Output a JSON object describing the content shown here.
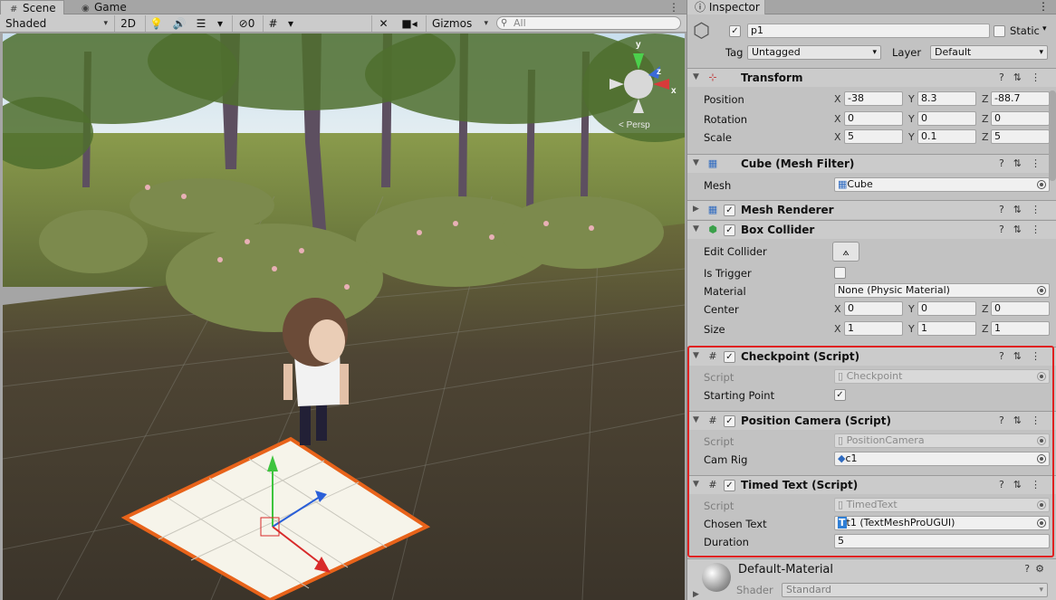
{
  "scene": {
    "tabs": [
      {
        "label": "Scene",
        "icon": "grid-icon"
      },
      {
        "label": "Game",
        "icon": "gamepad-icon"
      }
    ],
    "toolbar": {
      "shading": "Shaded",
      "mode_2d": "2D",
      "hidden_count": "0",
      "gizmos": "Gizmos",
      "search_placeholder": "All"
    },
    "gizmo": {
      "y_label": "y",
      "z_label": "z",
      "x_label": "x",
      "persp_label": "< Persp"
    }
  },
  "inspector": {
    "tab_label": "Inspector",
    "object": {
      "name": "p1",
      "active": true,
      "static_label": "Static",
      "tag_label": "Tag",
      "tag_value": "Untagged",
      "layer_label": "Layer",
      "layer_value": "Default"
    },
    "transform": {
      "title": "Transform",
      "position": {
        "label": "Position",
        "x": "-38",
        "y": "8.3",
        "z": "-88.7"
      },
      "rotation": {
        "label": "Rotation",
        "x": "0",
        "y": "0",
        "z": "0"
      },
      "scale": {
        "label": "Scale",
        "x": "5",
        "y": "0.1",
        "z": "5"
      }
    },
    "mesh_filter": {
      "title": "Cube (Mesh Filter)",
      "mesh_label": "Mesh",
      "mesh_value": "Cube"
    },
    "mesh_renderer": {
      "title": "Mesh Renderer"
    },
    "box_collider": {
      "title": "Box Collider",
      "edit_label": "Edit Collider",
      "trigger_label": "Is Trigger",
      "material_label": "Material",
      "material_value": "None (Physic Material)",
      "center": {
        "label": "Center",
        "x": "0",
        "y": "0",
        "z": "0"
      },
      "size": {
        "label": "Size",
        "x": "1",
        "y": "1",
        "z": "1"
      }
    },
    "checkpoint": {
      "title": "Checkpoint (Script)",
      "script_label": "Script",
      "script_value": "Checkpoint",
      "starting_label": "Starting Point"
    },
    "position_camera": {
      "title": "Position Camera (Script)",
      "script_label": "Script",
      "script_value": "PositionCamera",
      "camrig_label": "Cam Rig",
      "camrig_value": "c1"
    },
    "timed_text": {
      "title": "Timed Text (Script)",
      "script_label": "Script",
      "script_value": "TimedText",
      "chosen_label": "Chosen Text",
      "chosen_value": "t1 (TextMeshProUGUI)",
      "duration_label": "Duration",
      "duration_value": "5"
    },
    "material": {
      "name": "Default-Material",
      "shader_label": "Shader",
      "shader_value": "Standard"
    }
  },
  "colors": {
    "selection_outline": "#e8631a",
    "highlight_box": "#e02020",
    "inspector_bg": "#c2c2c2"
  }
}
